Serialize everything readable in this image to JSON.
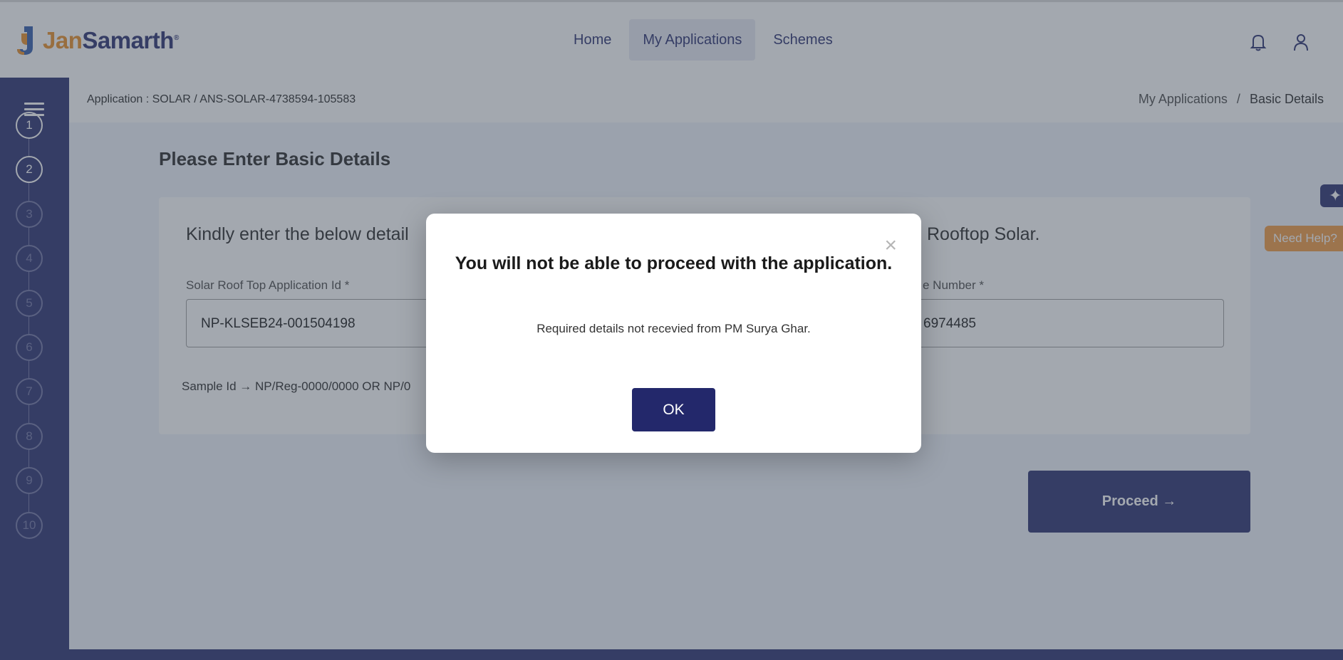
{
  "brand": {
    "name_part1": "Jan",
    "name_part2": "Samarth",
    "mark": "®"
  },
  "nav": {
    "items": [
      {
        "label": "Home"
      },
      {
        "label": "My Applications"
      },
      {
        "label": "Schemes"
      }
    ]
  },
  "header_icons": [
    "bell-icon",
    "user-icon"
  ],
  "sidebar": {
    "steps": [
      "1",
      "2",
      "3",
      "4",
      "5",
      "6",
      "7",
      "8",
      "9",
      "10"
    ],
    "active_steps": 2
  },
  "crumb_bar": {
    "application_label": "Application : SOLAR / ANS-SOLAR-4738594-105583",
    "breadcrumb": {
      "parent": "My Applications",
      "separator": "/",
      "current": "Basic Details"
    }
  },
  "main": {
    "title": "Please Enter Basic Details",
    "card": {
      "heading_left": "Kindly enter the below detail",
      "heading_right": "Rooftop Solar.",
      "field1": {
        "label": "Solar Roof Top Application Id *",
        "value": "NP-KLSEB24-001504198"
      },
      "field2": {
        "label": "e Number *",
        "value": "6974485"
      },
      "sample": "Sample Id → NP/Reg-0000/0000 OR NP/0"
    },
    "proceed_label": "Proceed",
    "proceed_arrow": "→"
  },
  "side_tabs": {
    "need_help": "Need Help?",
    "chat_icon": "sparkle-icon"
  },
  "colors": {
    "primary": "#23286b",
    "accent": "#f0963a",
    "brand_orange": "#e98a1f"
  },
  "modal": {
    "close": "×",
    "title": "You will not be able to proceed with the application.",
    "message": "Required details not recevied from PM Surya Ghar.",
    "ok_label": "OK"
  }
}
